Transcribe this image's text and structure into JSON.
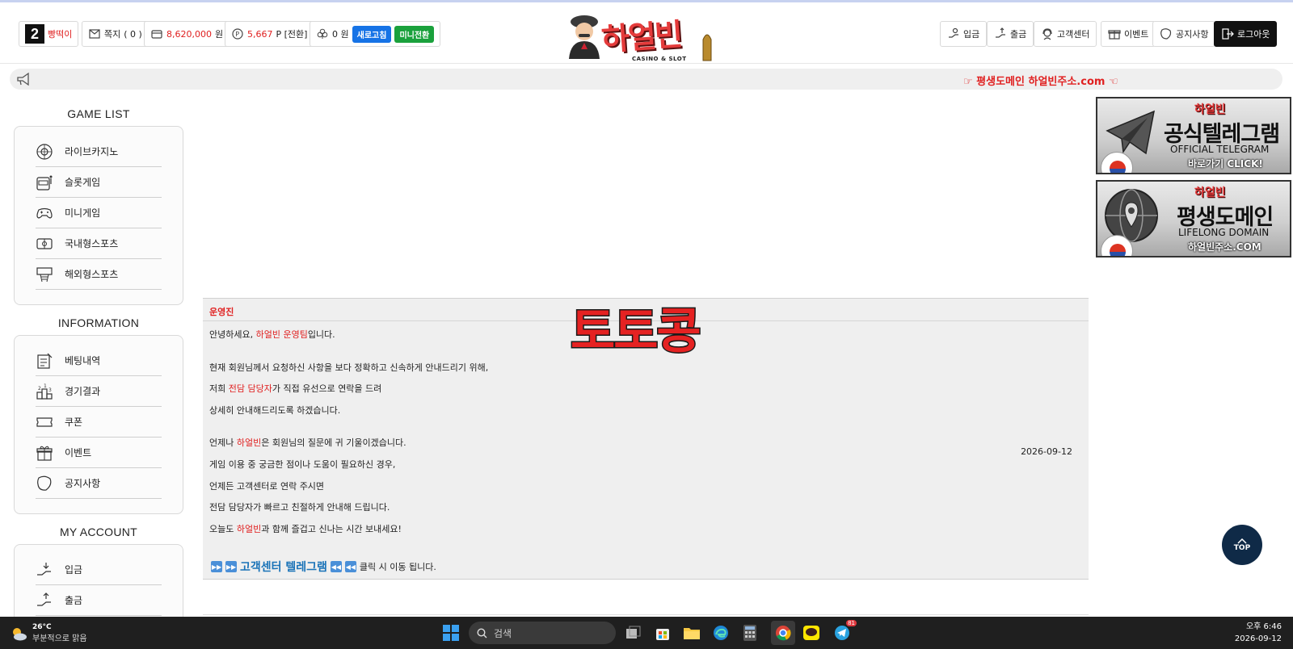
{
  "header": {
    "level_number": "2",
    "nickname": "빵떡이",
    "memo_label": "쪽지",
    "memo_count": "( 0 )",
    "money_amount": "8,620,000",
    "money_unit": "원",
    "point_amount": "5,667",
    "point_unit": "P [전환]",
    "casino_money": "0 원",
    "refresh_label": "새로고침",
    "mini_switch_label": "미니전환",
    "logo_text": "하얼빈",
    "logo_sub": "CASINO & SLOT",
    "buttons": {
      "deposit": "입금",
      "withdraw": "출금",
      "support": "고객센터",
      "event": "이벤트",
      "notice": "공지사항",
      "logout": "로그아웃"
    }
  },
  "notice_bar": {
    "message": "☞ 평생도메인 하얼빈주소.com ☜"
  },
  "sidebar": {
    "game_list_title": "GAME LIST",
    "game_list": [
      "라이브카지노",
      "슬롯게임",
      "미니게임",
      "국내형스포츠",
      "해외형스포츠"
    ],
    "information_title": "INFORMATION",
    "information": [
      "베팅내역",
      "경기결과",
      "쿠폰",
      "이벤트",
      "공지사항"
    ],
    "account_title": "MY ACCOUNT",
    "account": [
      "입금",
      "출금"
    ]
  },
  "post": {
    "author": "운영진",
    "greeting_pre": "안녕하세요, ",
    "greeting_red": "하얼빈 운영팀",
    "greeting_post": "입니다.",
    "line2": "현재 회원님께서 요청하신 사항을 보다 정확하고 신속하게 안내드리기 위해,",
    "line3_pre": "저희 ",
    "line3_red": "전담 담당자",
    "line3_post": "가 직접 유선으로 연락을 드려",
    "line4": "상세히 안내해드리도록 하겠습니다.",
    "line5_pre": "언제나 ",
    "line5_red": "하얼빈",
    "line5_post": "은 회원님의 질문에 귀 기울이겠습니다.",
    "line6": "게임 이용 중 궁금한 점이나 도움이 필요하신 경우,",
    "line7": "언제든 고객센터로 연락 주시면",
    "line8": "전담 담당자가 빠르고 친절하게 안내해 드립니다.",
    "line9_pre": "오늘도 ",
    "line9_red": "하얼빈",
    "line9_post": "과 함께 즐겁고 신나는 시간 보내세요!",
    "telegram_link": "고객센터 텔레그램",
    "telegram_hint": "클릭 시 이동 됩니다.",
    "date": "2026-09-12"
  },
  "watermark": "토토콩",
  "banners": [
    {
      "logo": "하얼빈",
      "title": "공식텔레그램",
      "subtitle": "OFFICIAL TELEGRAM",
      "cta": "바로가기 CLICK!"
    },
    {
      "logo": "하얼빈",
      "title": "평생도메인",
      "subtitle": "LIFELONG DOMAIN",
      "cta": "하얼빈주소.COM"
    }
  ],
  "top_button": "TOP",
  "taskbar": {
    "temperature": "26°C",
    "weather": "부분적으로 맑음",
    "search_placeholder": "검색",
    "telegram_badge": "81",
    "time": "오후 6:46",
    "date": "2026-09-12"
  },
  "colors": {
    "accent_red": "#e02020",
    "blue_pill": "#1673e6",
    "green_pill": "#1aa13c",
    "top_button": "#0f2a47"
  }
}
